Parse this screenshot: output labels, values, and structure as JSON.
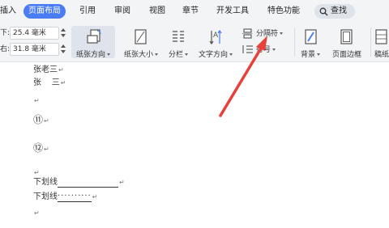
{
  "tabs": [
    {
      "label": "插入",
      "active": false
    },
    {
      "label": "页面布局",
      "active": true
    },
    {
      "label": "引用",
      "active": false
    },
    {
      "label": "审阅",
      "active": false
    },
    {
      "label": "视图",
      "active": false
    },
    {
      "label": "章节",
      "active": false
    },
    {
      "label": "开发工具",
      "active": false
    },
    {
      "label": "特色功能",
      "active": false
    }
  ],
  "search": {
    "label": "查找",
    "icon": "search-icon"
  },
  "ribbon": {
    "margin_top": {
      "label": "下:",
      "value": "25.4 毫米"
    },
    "margin_right": {
      "label": "右:",
      "value": "31.8 毫米"
    },
    "orientation_label": "纸张方向",
    "size_label": "纸张大小",
    "columns_label": "分栏",
    "text_direction_label": "文字方向",
    "separator_label": "分隔符",
    "line_number_label": "行号",
    "background_label": "背景",
    "page_border_label": "页面边框",
    "draft_label": "稿纸"
  },
  "document": {
    "lines": [
      "张老三",
      "张    三",
      "",
      "⑪",
      "",
      "⑫",
      "",
      "下划线",
      "下划线"
    ],
    "underline_fill": "",
    "dotted_fill": "··········"
  },
  "colors": {
    "accent": "#4a7cf6",
    "arrow": "#e8403a",
    "ribbon_bg": "#f3f4f6"
  }
}
